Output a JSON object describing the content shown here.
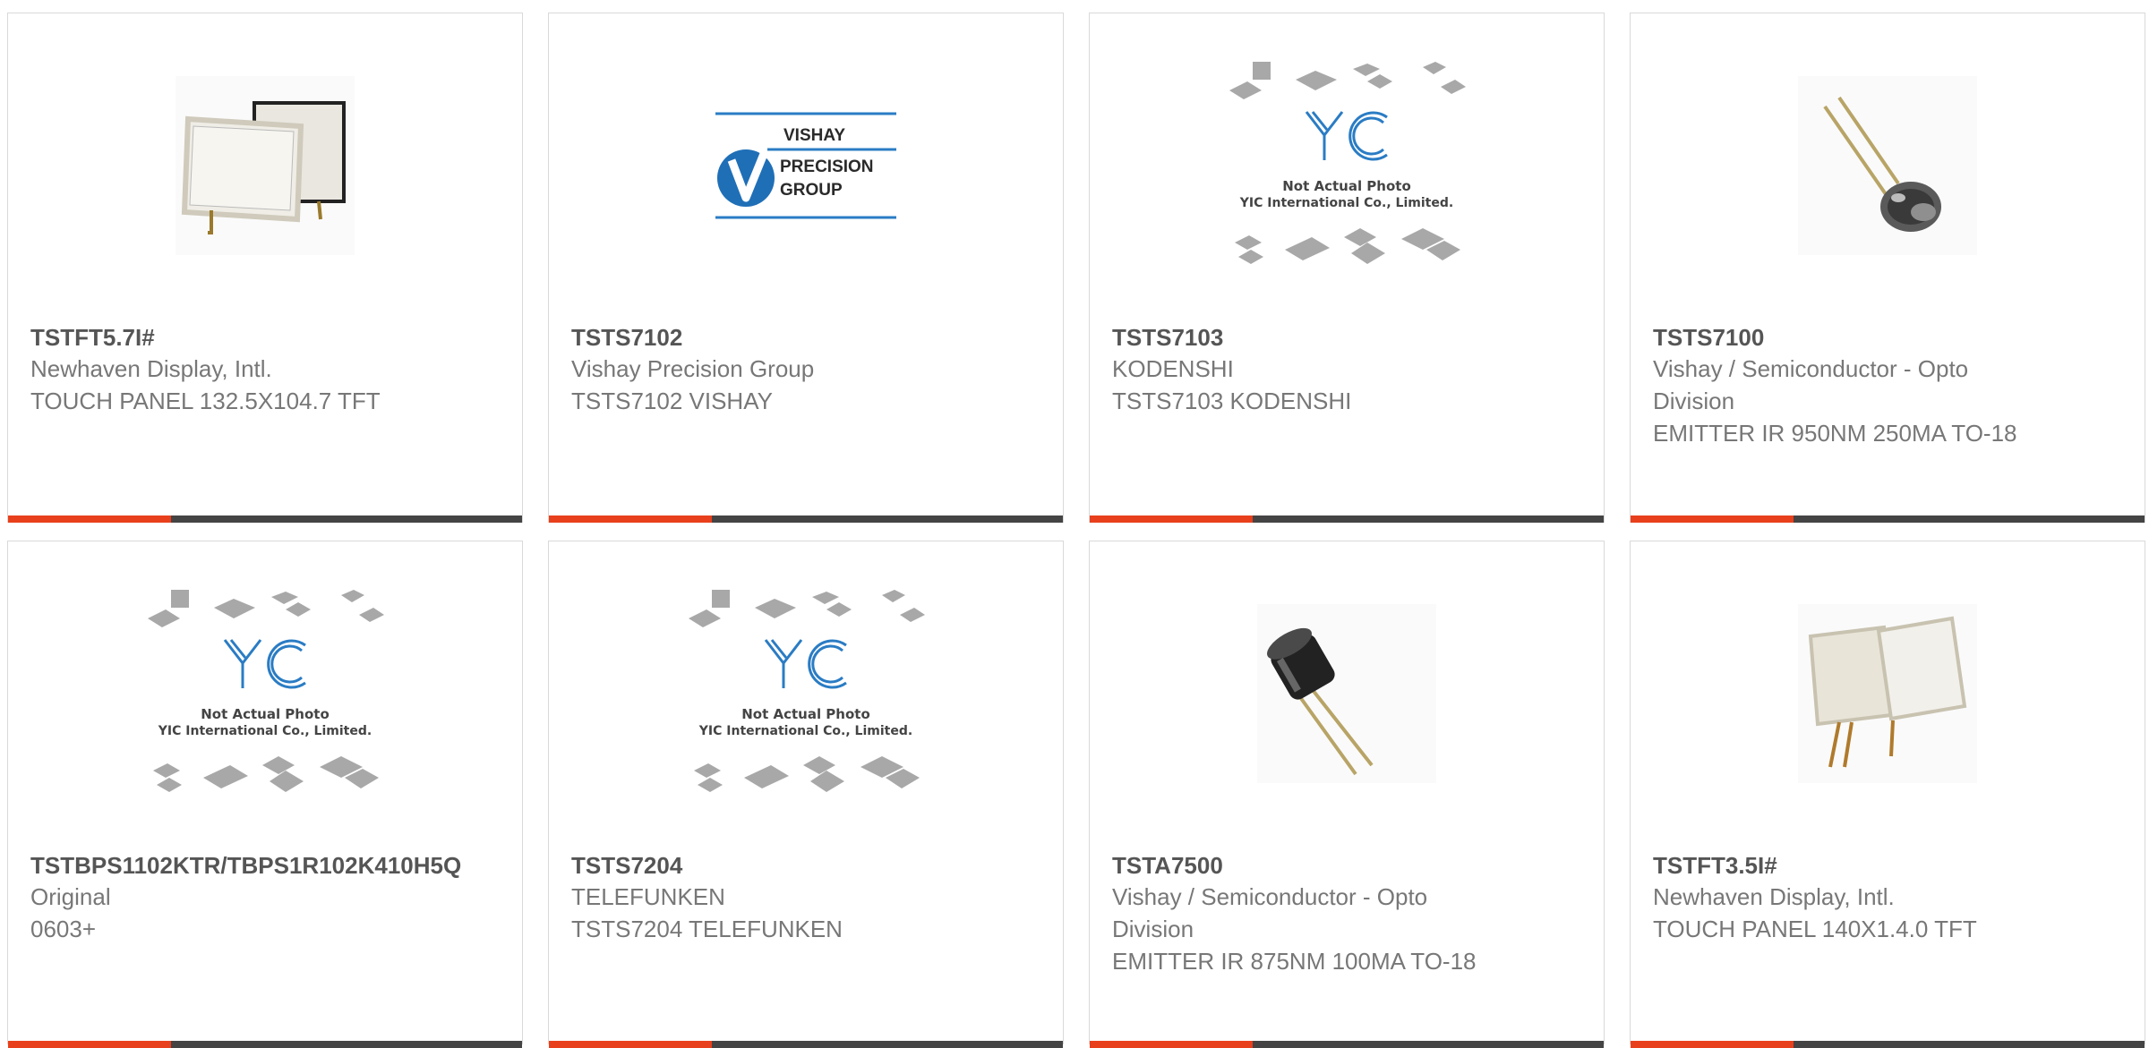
{
  "colors": {
    "accent": "#e8401c",
    "bar": "#444444",
    "title": "#555555",
    "text": "#777777",
    "border": "#d9d9d9",
    "yic_blue": "#2a7cc4"
  },
  "products": [
    {
      "part_number": "TSTFT5.7I#",
      "manufacturer": "Newhaven Display, Intl.",
      "description": "TOUCH PANEL 132.5X104.7 TFT",
      "image": "touch-panel-photo"
    },
    {
      "part_number": "TSTS7102",
      "manufacturer": "Vishay Precision Group",
      "description": "TSTS7102 VISHAY",
      "image": "vishay-precision-group-logo",
      "logo_text": [
        "VISHAY",
        "PRECISION",
        "GROUP"
      ]
    },
    {
      "part_number": "TSTS7103",
      "manufacturer": "KODENSHI",
      "description": "TSTS7103 KODENSHI",
      "image": "yic-placeholder",
      "placeholder_text": [
        "Not Actual Photo",
        "YIC International Co., Limited."
      ]
    },
    {
      "part_number": "TSTS7100",
      "manufacturer": "Vishay / Semiconductor - Opto Division",
      "description": "EMITTER IR 950NM 250MA TO-18",
      "image": "ir-emitter-to18-photo"
    },
    {
      "part_number": "TSTBPS1102KTR/TBPS1R102K410H5Q",
      "manufacturer": "Original",
      "description": "0603+",
      "image": "yic-placeholder",
      "placeholder_text": [
        "Not Actual Photo",
        "YIC International Co., Limited."
      ]
    },
    {
      "part_number": "TSTS7204",
      "manufacturer": "TELEFUNKEN",
      "description": "TSTS7204 TELEFUNKEN",
      "image": "yic-placeholder",
      "placeholder_text": [
        "Not Actual Photo",
        "YIC International Co., Limited."
      ]
    },
    {
      "part_number": "TSTA7500",
      "manufacturer": "Vishay / Semiconductor - Opto Division",
      "description": "EMITTER IR 875NM 100MA TO-18",
      "image": "ir-emitter-black-photo"
    },
    {
      "part_number": "TSTFT3.5I#",
      "manufacturer": "Newhaven Display, Intl.",
      "description": "TOUCH PANEL 140X1.4.0 TFT",
      "image": "touch-panel-photo"
    }
  ]
}
